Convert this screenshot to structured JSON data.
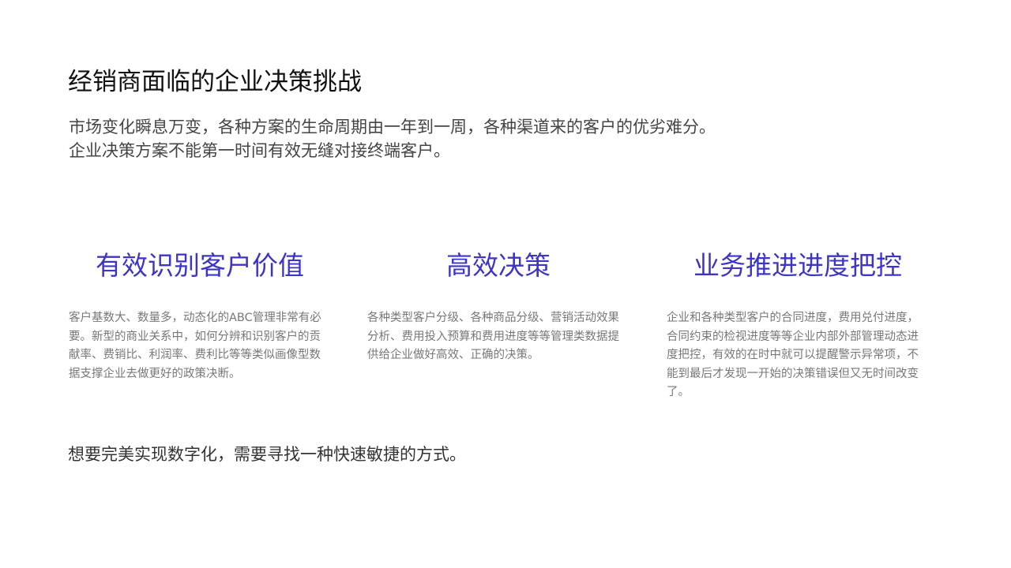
{
  "title": "经销商面临的企业决策挑战",
  "intro": {
    "line1": "市场变化瞬息万变，各种方案的生命周期由一年到一周，各种渠道来的客户的优劣难分。",
    "line2": "企业决策方案不能第一时间有效无缝对接终端客户。"
  },
  "columns": [
    {
      "heading": "有效识别客户价值",
      "body": "客户基数大、数量多，动态化的ABC管理非常有必要。新型的商业关系中，如何分辨和识别客户的贡献率、费销比、利润率、费利比等等类似画像型数据支撑企业去做更好的政策决断。"
    },
    {
      "heading": "高效决策",
      "body": "各种类型客户分级、各种商品分级、营销活动效果分析、费用投入预算和费用进度等等管理类数据提供给企业做好高效、正确的决策。"
    },
    {
      "heading": "业务推进进度把控",
      "body": "企业和各种类型客户的合同进度，费用兑付进度，合同约束的检视进度等等企业内部外部管理动态进度把控，有效的在时中就可以提醒警示异常项，不能到最后才发现一开始的决策错误但又无时间改变了。"
    }
  ],
  "conclusion": "想要完美实现数字化，需要寻找一种快速敏捷的方式。",
  "colors": {
    "heading_accent": "#3d35c4",
    "title": "#111111",
    "body_text": "#777777"
  }
}
